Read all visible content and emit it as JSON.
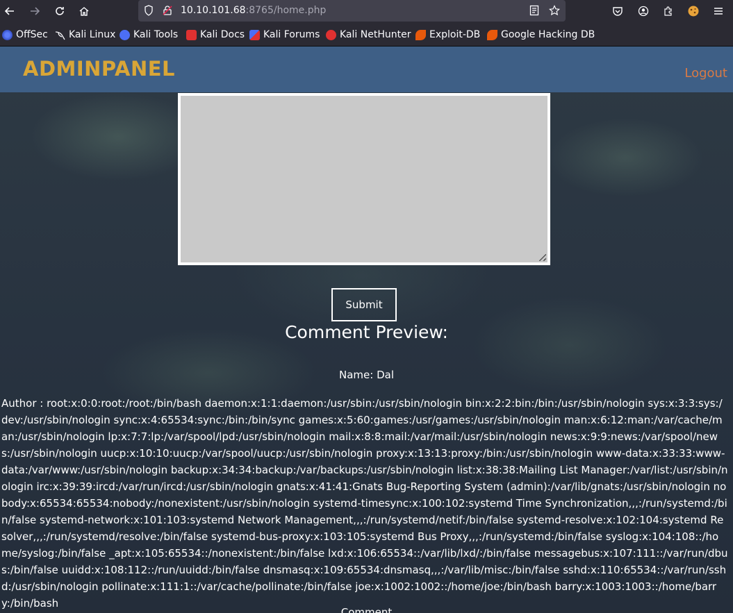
{
  "browser": {
    "url_host": "10.10.101.68",
    "url_rest": ":8765/home.php",
    "bookmarks": [
      {
        "label": "OffSec",
        "color": "#3b5bdb"
      },
      {
        "label": "Kali Linux",
        "color": "#2b2a33"
      },
      {
        "label": "Kali Tools",
        "color": "#4c6ef5"
      },
      {
        "label": "Kali Docs",
        "color": "#e03131"
      },
      {
        "label": "Kali Forums",
        "color": "#4c6ef5"
      },
      {
        "label": "Kali NetHunter",
        "color": "#e03131"
      },
      {
        "label": "Exploit-DB",
        "color": "#e8590c"
      },
      {
        "label": "Google Hacking DB",
        "color": "#e8590c"
      }
    ]
  },
  "navbar": {
    "brand": "ADMINPANEL",
    "logout": "Logout"
  },
  "form": {
    "submit_label": "Submit"
  },
  "preview": {
    "title": "Comment Preview:",
    "name_line": "Name: Dal",
    "author_line": "Author : root:x:0:0:root:/root:/bin/bash daemon:x:1:1:daemon:/usr/sbin:/usr/sbin/nologin bin:x:2:2:bin:/bin:/usr/sbin/nologin sys:x:3:3:sys:/dev:/usr/sbin/nologin sync:x:4:65534:sync:/bin:/bin/sync games:x:5:60:games:/usr/games:/usr/sbin/nologin man:x:6:12:man:/var/cache/man:/usr/sbin/nologin lp:x:7:7:lp:/var/spool/lpd:/usr/sbin/nologin mail:x:8:8:mail:/var/mail:/usr/sbin/nologin news:x:9:9:news:/var/spool/news:/usr/sbin/nologin uucp:x:10:10:uucp:/var/spool/uucp:/usr/sbin/nologin proxy:x:13:13:proxy:/bin:/usr/sbin/nologin www-data:x:33:33:www-data:/var/www:/usr/sbin/nologin backup:x:34:34:backup:/var/backups:/usr/sbin/nologin list:x:38:38:Mailing List Manager:/var/list:/usr/sbin/nologin irc:x:39:39:ircd:/var/run/ircd:/usr/sbin/nologin gnats:x:41:41:Gnats Bug-Reporting System (admin):/var/lib/gnats:/usr/sbin/nologin nobody:x:65534:65534:nobody:/nonexistent:/usr/sbin/nologin systemd-timesync:x:100:102:systemd Time Synchronization,,,:/run/systemd:/bin/false systemd-network:x:101:103:systemd Network Management,,,:/run/systemd/netif:/bin/false systemd-resolve:x:102:104:systemd Resolver,,,:/run/systemd/resolve:/bin/false systemd-bus-proxy:x:103:105:systemd Bus Proxy,,,:/run/systemd:/bin/false syslog:x:104:108::/home/syslog:/bin/false _apt:x:105:65534::/nonexistent:/bin/false lxd:x:106:65534::/var/lib/lxd/:/bin/false messagebus:x:107:111::/var/run/dbus:/bin/false uuidd:x:108:112::/run/uuidd:/bin/false dnsmasq:x:109:65534:dnsmasq,,,:/var/lib/misc:/bin/false sshd:x:110:65534::/var/run/sshd:/usr/sbin/nologin pollinate:x:111:1::/var/cache/pollinate:/bin/false joe:x:1002:1002::/home/joe:/bin/bash barry:x:1003:1003::/home/barry:/bin/bash",
    "comment_cut": "Comment"
  }
}
